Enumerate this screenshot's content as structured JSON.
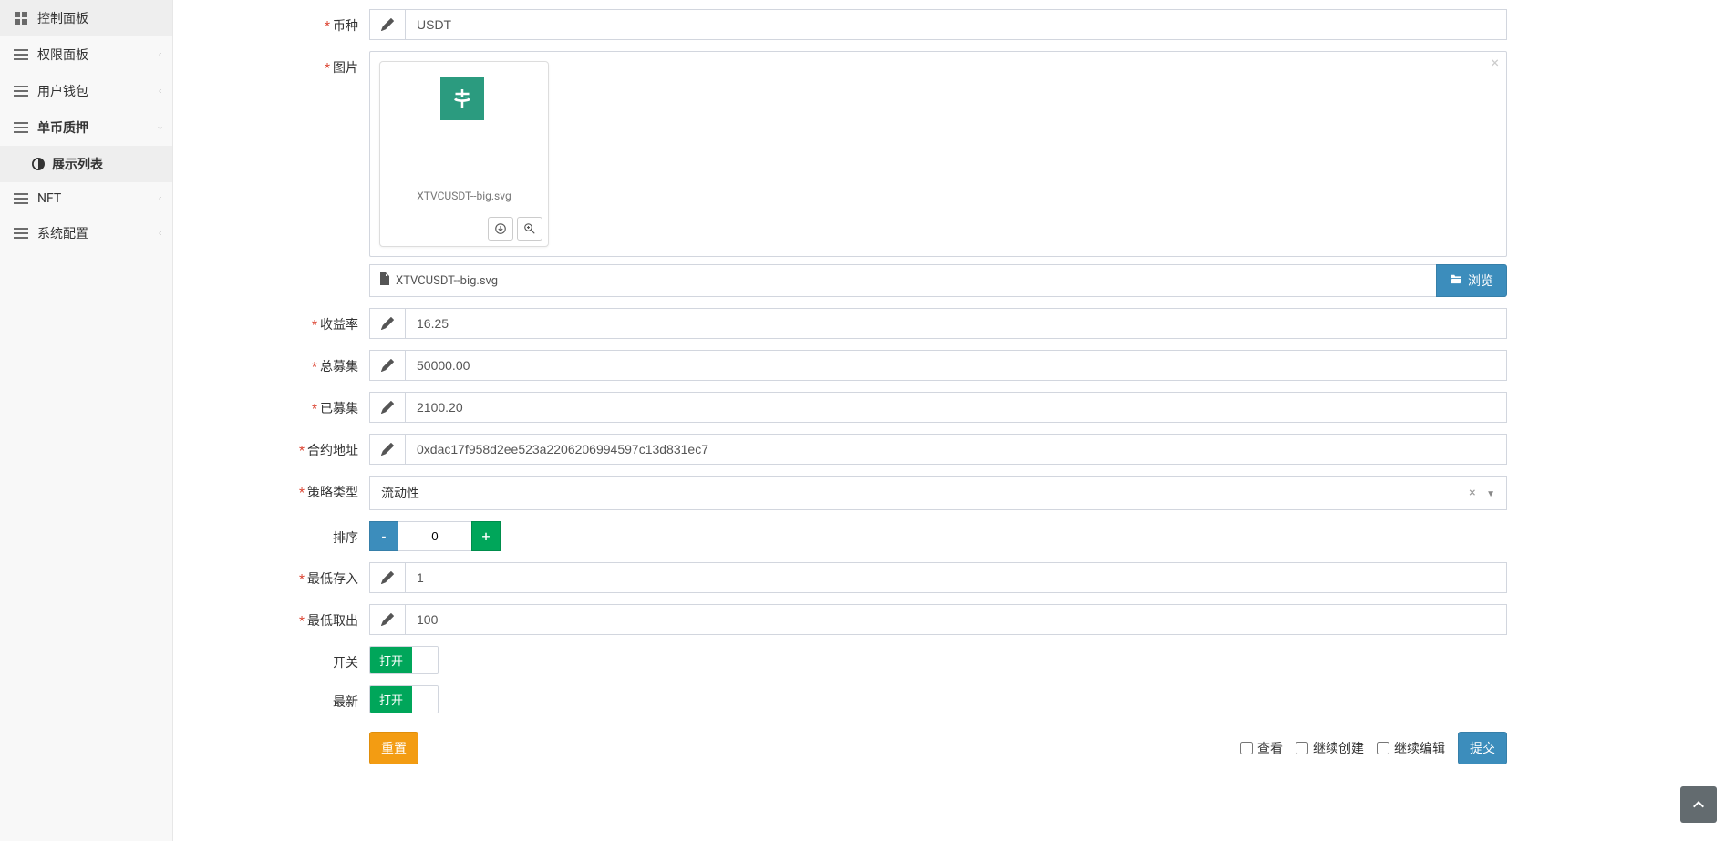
{
  "sidebar": {
    "items": [
      {
        "label": "控制面板",
        "icon": "dashboard"
      },
      {
        "label": "权限面板",
        "icon": "list",
        "expandable": true
      },
      {
        "label": "用户钱包",
        "icon": "list",
        "expandable": true
      },
      {
        "label": "单币质押",
        "icon": "list",
        "expandable": true,
        "expanded": true
      },
      {
        "label": "NFT",
        "icon": "list",
        "expandable": true
      },
      {
        "label": "系统配置",
        "icon": "list",
        "expandable": true
      }
    ],
    "sub_item": {
      "label": "展示列表",
      "icon": "adjust"
    }
  },
  "form": {
    "currency": {
      "label": "币种",
      "value": "USDT"
    },
    "image": {
      "label": "图片",
      "filename": "XTVCUSDT--big.svg",
      "display_name": "XTVCUSDT--big.svg",
      "browse": "浏览"
    },
    "yield": {
      "label": "收益率",
      "value": "16.25"
    },
    "total_raise": {
      "label": "总募集",
      "value": "50000.00"
    },
    "raised": {
      "label": "已募集",
      "value": "2100.20"
    },
    "contract": {
      "label": "合约地址",
      "value": "0xdac17f958d2ee523a2206206994597c13d831ec7"
    },
    "strategy": {
      "label": "策略类型",
      "value": "流动性"
    },
    "sort": {
      "label": "排序",
      "value": "0"
    },
    "min_deposit": {
      "label": "最低存入",
      "value": "1"
    },
    "min_withdraw": {
      "label": "最低取出",
      "value": "100"
    },
    "switch": {
      "label": "开关",
      "state": "打开"
    },
    "latest": {
      "label": "最新",
      "state": "打开"
    }
  },
  "footer": {
    "reset": "重置",
    "view": "查看",
    "continue_create": "继续创建",
    "continue_edit": "继续编辑",
    "submit": "提交"
  }
}
